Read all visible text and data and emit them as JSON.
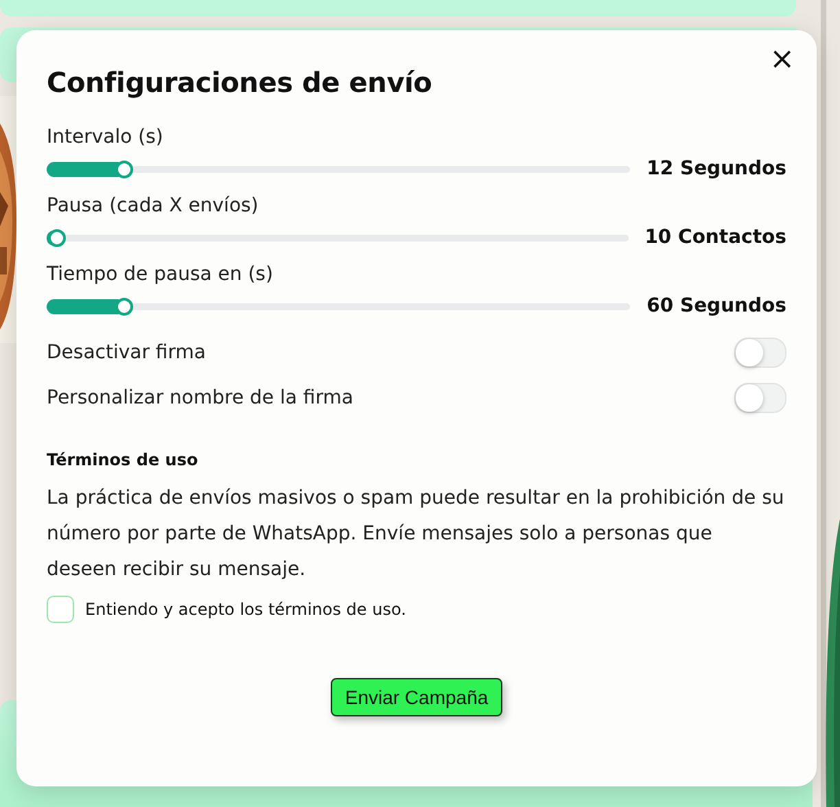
{
  "modal": {
    "title": "Configuraciones de envío",
    "close": "×",
    "sliders": [
      {
        "label": "Intervalo (s)",
        "level": 0.135,
        "reading": "12 Segundos"
      },
      {
        "label": "Pausa (cada X envíos)",
        "level": 0.02,
        "reading": "10 Contactos"
      },
      {
        "label": "Tiempo de pausa en (s)",
        "level": 0.135,
        "reading": "60 Segundos"
      }
    ],
    "toggles": [
      {
        "label": "Desactivar firma",
        "on": false
      },
      {
        "label": "Personalizar nombre de la firma",
        "on": false
      }
    ],
    "terms": {
      "heading": "Términos de uso",
      "text": "La práctica de envíos masivos o spam puede resultar en la prohibición de su número por parte de WhatsApp. Envíe mensajes solo a personas que deseen recibir su mensaje.",
      "checkbox": {
        "label": "Entiendo y acepto los términos de uso.",
        "checked": false
      }
    },
    "submit": "Enviar Campaña"
  }
}
